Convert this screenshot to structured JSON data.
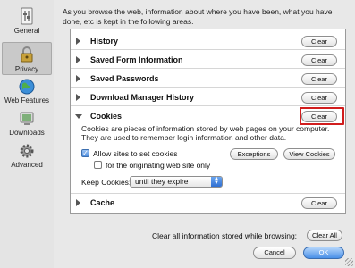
{
  "sidebar": {
    "items": [
      {
        "label": "General",
        "icon": "general-icon"
      },
      {
        "label": "Privacy",
        "icon": "privacy-icon",
        "selected": true
      },
      {
        "label": "Web Features",
        "icon": "globe-icon"
      },
      {
        "label": "Downloads",
        "icon": "downloads-icon"
      },
      {
        "label": "Advanced",
        "icon": "gear-icon"
      }
    ]
  },
  "intro": "As you browse the web, information about where you have been, what you have done, etc is kept in the following areas.",
  "sections": [
    {
      "label": "History",
      "button": "Clear",
      "expanded": false
    },
    {
      "label": "Saved Form Information",
      "button": "Clear",
      "expanded": false
    },
    {
      "label": "Saved Passwords",
      "button": "Clear",
      "expanded": false
    },
    {
      "label": "Download Manager History",
      "button": "Clear",
      "expanded": false
    },
    {
      "label": "Cookies",
      "button": "Clear",
      "expanded": true
    },
    {
      "label": "Cache",
      "button": "Clear",
      "expanded": false
    }
  ],
  "cookies": {
    "description": "Cookies are pieces of information stored by web pages on your computer. They are used to remember login information and other data.",
    "allow_label": "Allow sites to set cookies",
    "allow_checked": true,
    "origin_only_label": "for the originating web site only",
    "origin_only_checked": false,
    "exceptions_button": "Exceptions",
    "view_button": "View Cookies",
    "keep_label": "Keep Cookies:",
    "keep_value": "until they expire"
  },
  "footer": {
    "clear_all_text": "Clear all information stored while browsing:",
    "clear_all_button": "Clear All",
    "cancel_button": "Cancel",
    "ok_button": "OK"
  },
  "colors": {
    "highlight": "#d11d1d",
    "ok_button": "#4a90e8"
  }
}
